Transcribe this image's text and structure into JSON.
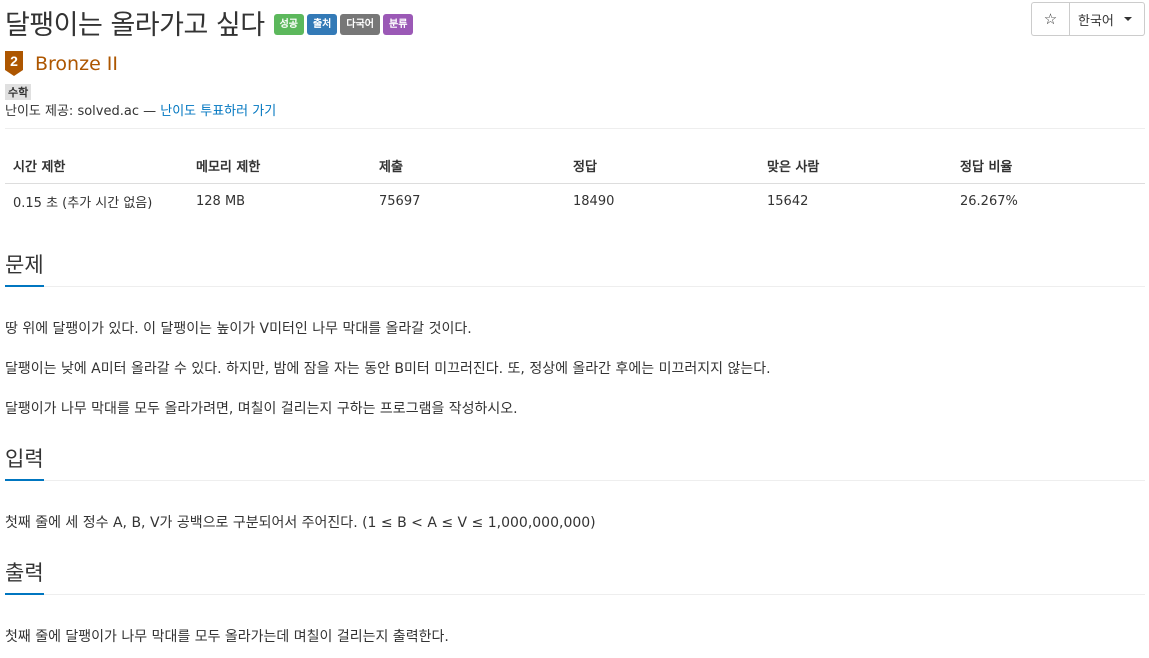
{
  "problem": {
    "title": "달팽이는 올라가고 싶다",
    "labels": [
      {
        "text": "성공",
        "color": "#5cb85c"
      },
      {
        "text": "출처",
        "color": "#337ab7"
      },
      {
        "text": "다국어",
        "color": "#777777"
      },
      {
        "text": "분류",
        "color": "#9b59b6"
      }
    ],
    "tier": {
      "number": "2",
      "name": "Bronze II",
      "color": "#ad5600"
    },
    "tags": [
      "수학"
    ],
    "credit_prefix": "난이도 제공: solved.ac — ",
    "credit_link": "난이도 투표하러 가기"
  },
  "toolbar": {
    "star_icon": "☆",
    "language": "한국어"
  },
  "info_table": {
    "headers": [
      "시간 제한",
      "메모리 제한",
      "제출",
      "정답",
      "맞은 사람",
      "정답 비율"
    ],
    "row": [
      "0.15 초 (추가 시간 없음)",
      "128 MB",
      "75697",
      "18490",
      "15642",
      "26.267%"
    ]
  },
  "sections": {
    "description": {
      "heading": "문제",
      "paragraphs": [
        "땅 위에 달팽이가 있다. 이 달팽이는 높이가 V미터인 나무 막대를 올라갈 것이다.",
        "달팽이는 낮에 A미터 올라갈 수 있다. 하지만, 밤에 잠을 자는 동안 B미터 미끄러진다. 또, 정상에 올라간 후에는 미끄러지지 않는다.",
        "달팽이가 나무 막대를 모두 올라가려면, 며칠이 걸리는지 구하는 프로그램을 작성하시오."
      ]
    },
    "input": {
      "heading": "입력",
      "paragraphs": [
        "첫째 줄에 세 정수 A, B, V가 공백으로 구분되어서 주어진다. (1 ≤ B < A ≤ V ≤ 1,000,000,000)"
      ]
    },
    "output": {
      "heading": "출력",
      "paragraphs": [
        "첫째 줄에 달팽이가 나무 막대를 모두 올라가는데 며칠이 걸리는지 출력한다."
      ]
    }
  }
}
